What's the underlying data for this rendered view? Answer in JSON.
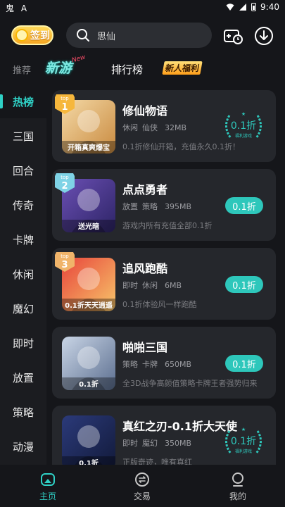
{
  "status_bar": {
    "left_icons": [
      "鬼",
      "A"
    ],
    "time": "9:40"
  },
  "header": {
    "checkin_label": "签到",
    "search_placeholder": "思仙"
  },
  "subtabs": {
    "recommend": "推荐",
    "new_games": "新游",
    "new_tag": "New",
    "ranking": "排行榜",
    "newbie": "新人福利"
  },
  "sidebar": {
    "items": [
      {
        "label": "热榜",
        "active": true
      },
      {
        "label": "三国"
      },
      {
        "label": "回合"
      },
      {
        "label": "传奇"
      },
      {
        "label": "卡牌"
      },
      {
        "label": "休闲"
      },
      {
        "label": "魔幻"
      },
      {
        "label": "即时"
      },
      {
        "label": "放置"
      },
      {
        "label": "策略"
      },
      {
        "label": "动漫"
      }
    ]
  },
  "games": [
    {
      "title": "修仙物语",
      "tags": [
        "休闲",
        "仙侠"
      ],
      "size": "32MB",
      "desc": "0.1折修仙开箱，充值永久0.1折！",
      "discount": "0.1折",
      "badge_style": "laurel",
      "laurel_label": "福利游戏",
      "rank_label": "top",
      "rank_num": "1",
      "rank_color": "#f6b73c",
      "thumb_label": "开箱真爽爆宝",
      "thumb_colors": [
        "#f4d9a6",
        "#c98a3f"
      ]
    },
    {
      "title": "点点勇者",
      "tags": [
        "放置",
        "策略"
      ],
      "size": "395MB",
      "desc": "游戏内所有充值全部0.1折",
      "discount": "0.1折",
      "badge_style": "pill",
      "rank_label": "top",
      "rank_num": "2",
      "rank_color": "#7fd3e6",
      "thumb_label": "送光暗",
      "thumb_colors": [
        "#6a4fb3",
        "#2d2466"
      ]
    },
    {
      "title": "追风跑酷",
      "tags": [
        "即时",
        "休闲"
      ],
      "size": "6MB",
      "desc": "0.1折体验风一样跑酷",
      "discount": "0.1折",
      "badge_style": "pill",
      "rank_label": "top",
      "rank_num": "3",
      "rank_color": "#f0b46a",
      "thumb_label": "0.1折天天逍遥",
      "thumb_colors": [
        "#e8453c",
        "#f7c66a"
      ]
    },
    {
      "title": "啪啪三国",
      "tags": [
        "策略",
        "卡牌"
      ],
      "size": "650MB",
      "desc": "全3D战争高颜值策略卡牌王者强势归来",
      "discount": "0.1折",
      "badge_style": "pill",
      "thumb_label": "0.1折",
      "thumb_colors": [
        "#c9d5e6",
        "#5b6e8f"
      ]
    },
    {
      "title": "真红之刃-0.1折大天使",
      "tags": [
        "即时",
        "魔幻"
      ],
      "size": "350MB",
      "desc": "正版奇迹，唯有真红",
      "discount": "0.1折",
      "badge_style": "laurel",
      "laurel_label": "福利游戏",
      "thumb_label": "0.1折",
      "thumb_colors": [
        "#2b3a7a",
        "#121a3a"
      ]
    }
  ],
  "bottom_nav": {
    "items": [
      {
        "label": "主页",
        "active": true
      },
      {
        "label": "交易"
      },
      {
        "label": "我的"
      }
    ]
  },
  "colors": {
    "accent": "#2fd1c6",
    "background": "#15161a",
    "card": "#25272c"
  }
}
